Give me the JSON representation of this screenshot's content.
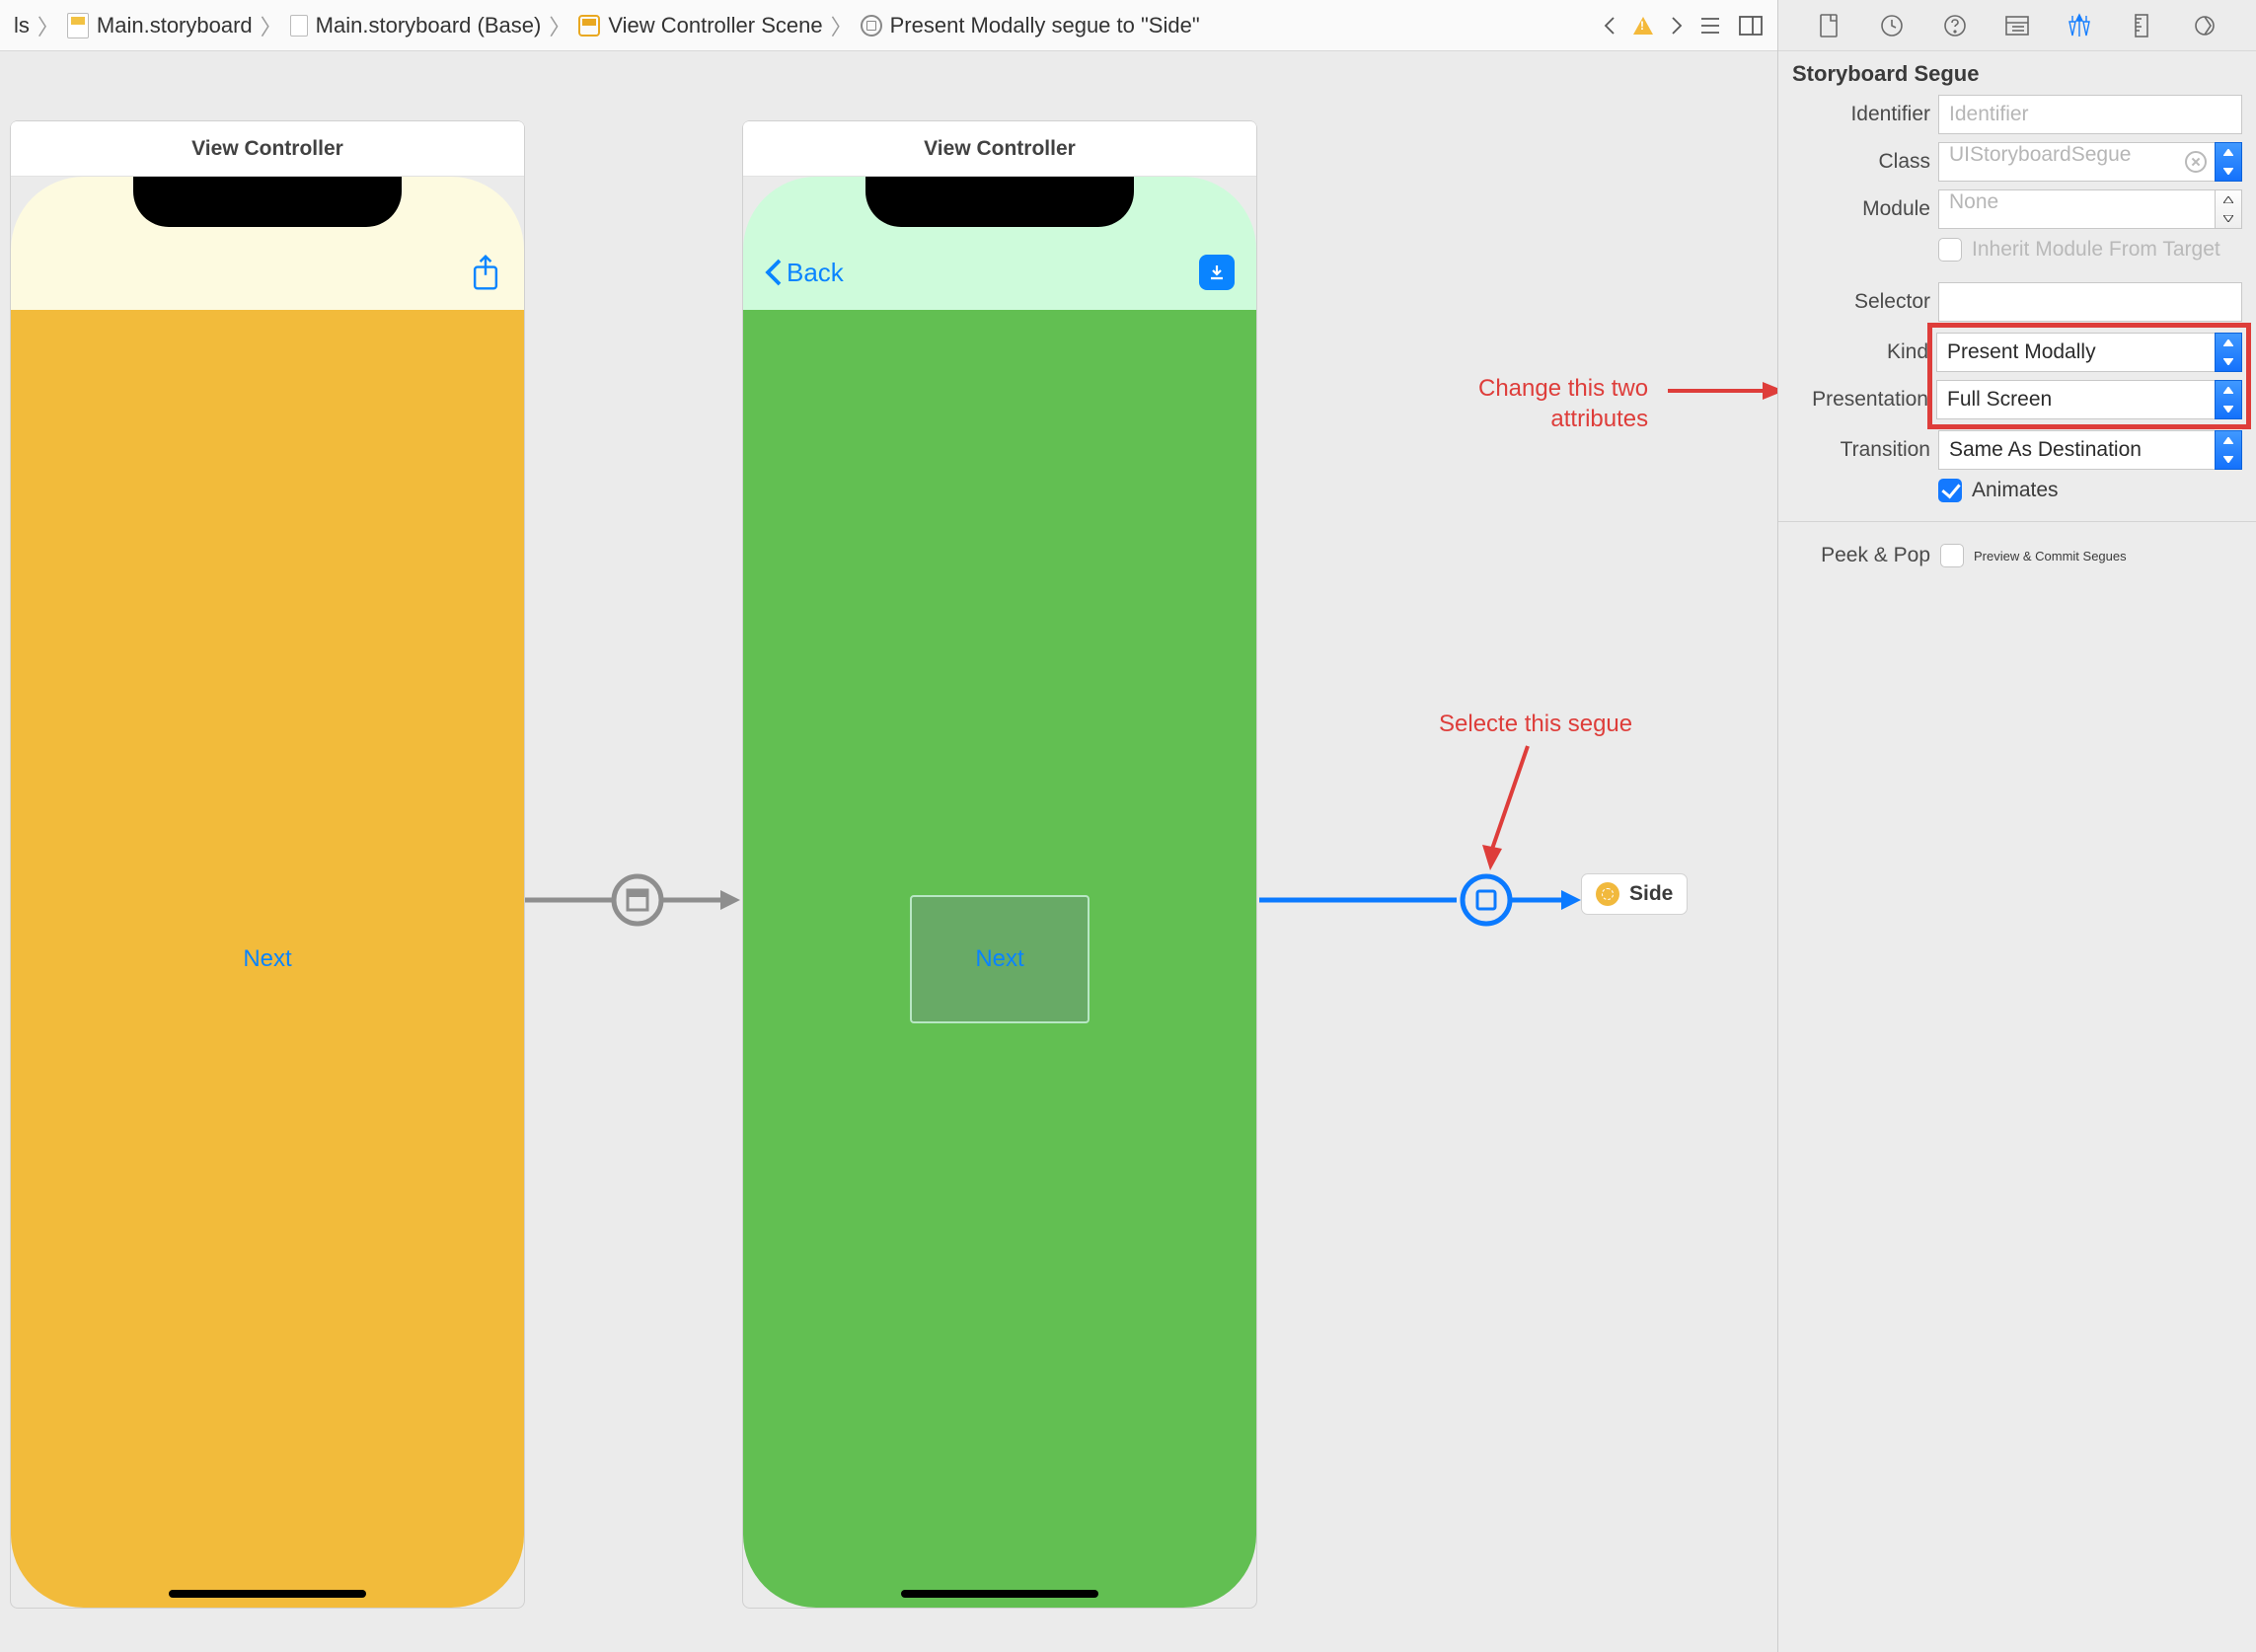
{
  "breadcrumb": {
    "seg0": "ls",
    "seg1": "Main.storyboard",
    "seg2": "Main.storyboard (Base)",
    "seg3": "View Controller Scene",
    "seg4": "Present Modally segue to \"Side\""
  },
  "devices": {
    "left": {
      "title": "View Controller",
      "button": "Next"
    },
    "right": {
      "title": "View Controller",
      "back": "Back",
      "button": "Next"
    }
  },
  "side_ref": {
    "label": "Side"
  },
  "annotations": {
    "segue": "Selecte this segue",
    "attrs_line1": "Change this two",
    "attrs_line2": "attributes"
  },
  "inspector": {
    "header": "Storyboard Segue",
    "identifier": {
      "label": "Identifier",
      "placeholder": "Identifier",
      "value": ""
    },
    "class": {
      "label": "Class",
      "placeholder": "UIStoryboardSegue",
      "value": ""
    },
    "module": {
      "label": "Module",
      "placeholder": "None",
      "value": ""
    },
    "inherit": {
      "label": "Inherit Module From Target",
      "checked": false
    },
    "selector": {
      "label": "Selector",
      "value": ""
    },
    "kind": {
      "label": "Kind",
      "value": "Present Modally"
    },
    "presentation": {
      "label": "Presentation",
      "value": "Full Screen"
    },
    "transition": {
      "label": "Transition",
      "value": "Same As Destination"
    },
    "animates": {
      "label": "Animates",
      "checked": true
    },
    "peek_label": "Peek & Pop",
    "peek_option": "Preview & Commit Segues"
  }
}
